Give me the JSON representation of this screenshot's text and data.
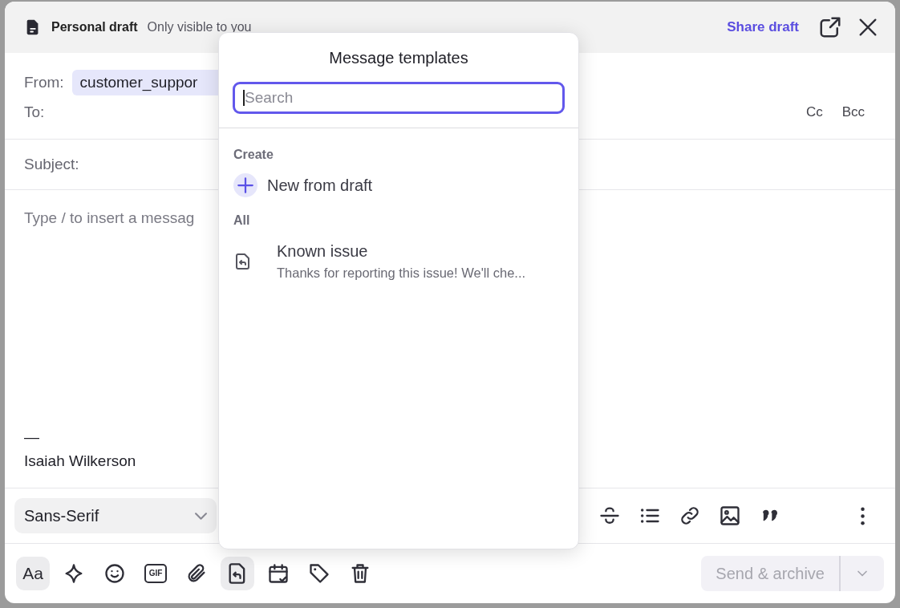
{
  "header": {
    "title": "Personal draft",
    "subtitle": "Only visible to you",
    "share_link": "Share draft"
  },
  "from": {
    "label": "From:",
    "value": "customer_suppor"
  },
  "to": {
    "label": "To:",
    "cc": "Cc",
    "bcc": "Bcc"
  },
  "subject": {
    "label": "Subject:"
  },
  "body": {
    "placeholder": "Type / to insert a messag",
    "signature_rule": "—",
    "signature": "Isaiah Wilkerson"
  },
  "format_toolbar": {
    "font": "Sans-Serif"
  },
  "bottom_toolbar": [
    {
      "kind": "text",
      "label": "Aa",
      "selected": true
    },
    {
      "kind": "icon",
      "selected": false
    },
    {
      "kind": "icon",
      "selected": false
    },
    {
      "kind": "badge",
      "label": "GIF",
      "selected": false
    },
    {
      "kind": "icon",
      "selected": false
    },
    {
      "kind": "icon",
      "selected": true
    },
    {
      "kind": "icon",
      "selected": false
    },
    {
      "kind": "icon",
      "selected": false
    },
    {
      "kind": "icon",
      "selected": false
    }
  ],
  "send_button": {
    "label": "Send & archive",
    "disabled": true
  },
  "templates_popup": {
    "title": "Message templates",
    "search": {
      "placeholder": "Search",
      "focused": true
    },
    "sections": [
      {
        "heading": "Create",
        "items": [
          {
            "kind": "create",
            "title": "New from draft"
          }
        ]
      },
      {
        "heading": "All",
        "items": [
          {
            "kind": "template",
            "title": "Known issue",
            "preview": "Thanks for reporting this issue! We'll che..."
          }
        ]
      }
    ]
  }
}
